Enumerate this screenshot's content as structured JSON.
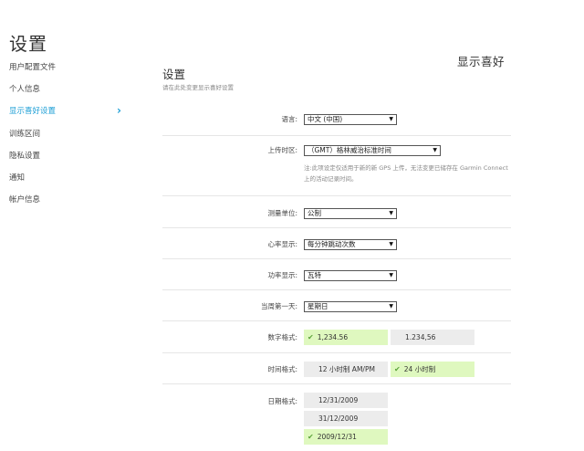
{
  "page": {
    "title": "设置"
  },
  "sidebar": {
    "items": [
      {
        "label": "用户配置文件"
      },
      {
        "label": "个人信息"
      },
      {
        "label": "显示喜好设置"
      },
      {
        "label": "训练区间"
      },
      {
        "label": "隐私设置"
      },
      {
        "label": "通知"
      },
      {
        "label": "帐户信息"
      }
    ],
    "active_chevron": "›"
  },
  "main": {
    "section_heading": "显示喜好",
    "panel_title": "设置",
    "panel_subtitle": "请在此处变更显示喜好设置",
    "language": {
      "label": "语言:",
      "value": "中文 (中国)"
    },
    "timezone": {
      "label": "上传时区:",
      "value": "（GMT）格林威治标准时间",
      "note": "注:此项设定仅适用于新的新 GPS 上传，无法变更已储存在 Garmin Connect 上的活动记录时间。"
    },
    "units": {
      "label": "测量单位:",
      "value": "公制"
    },
    "heart_rate": {
      "label": "心率显示:",
      "value": "每分钟跳动次数"
    },
    "power": {
      "label": "功率显示:",
      "value": "瓦特"
    },
    "first_day": {
      "label": "当周第一天:",
      "value": "星期日"
    },
    "number_format": {
      "label": "数字格式:",
      "options": [
        {
          "label": "1,234.56",
          "selected": true
        },
        {
          "label": "1.234,56",
          "selected": false
        }
      ]
    },
    "time_format": {
      "label": "时间格式:",
      "options": [
        {
          "label": "12 小时制 AM/PM",
          "selected": false
        },
        {
          "label": "24 小时制",
          "selected": true
        }
      ]
    },
    "date_format": {
      "label": "日期格式:",
      "options": [
        {
          "label": "12/31/2009",
          "selected": false
        },
        {
          "label": "31/12/2009",
          "selected": false
        },
        {
          "label": "2009/12/31",
          "selected": true
        }
      ]
    },
    "check_icon": "✔",
    "dropdown_arrow": "▼"
  },
  "colors": {
    "accent": "#1e9fd6",
    "selected_bg": "#dff8bf",
    "option_bg": "#ececec",
    "check": "#5ba33a"
  }
}
